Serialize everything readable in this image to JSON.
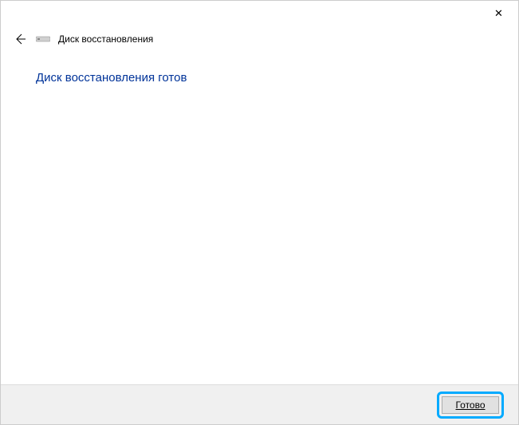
{
  "titlebar": {
    "close_label": "✕"
  },
  "header": {
    "wizard_title": "Диск восстановления"
  },
  "content": {
    "heading": "Диск восстановления готов"
  },
  "footer": {
    "finish_label": "Готово"
  }
}
